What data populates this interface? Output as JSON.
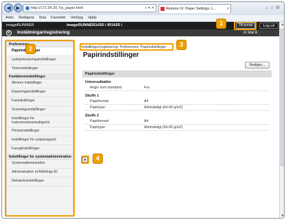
{
  "browser": {
    "back_glyph": "◀",
    "forward_glyph": "▶",
    "url": "http://172.24.20.7/p_paper.html",
    "url_tools": "⌕ ▾ ✕",
    "tab_label": "Remote UI: Paper Settings: L...",
    "tab_close": "×",
    "window_icons": "⌂☆⚙",
    "menu": [
      "Arkiv",
      "Redigera",
      "Visa",
      "Favoriter",
      "Verktyg",
      "Hjälp"
    ]
  },
  "header": {
    "left": "imageRUNNER",
    "model": "imageRUNNER1435 / iR1435 /",
    "portal_label": "Till portal",
    "logout_label": "Log ud",
    "app_icon": "⚙",
    "app_title": "Inställningar/registrering",
    "mail_label": "Mail til systemadministratör"
  },
  "sidebar": {
    "sections": [
      {
        "title": "Preferences",
        "items": [
          {
            "label": "Papirindstillinger",
            "active": true
          },
          {
            "label": "Lydstyrkestyringsindstillinger"
          },
          {
            "label": "Timerindstillinger"
          }
        ]
      },
      {
        "title": "Funktionsindstillinger",
        "items": [
          {
            "label": "Almene indstillinger"
          },
          {
            "label": "Kopieringsindstillinger"
          },
          {
            "label": "Faxindstillinger"
          },
          {
            "label": "Scanningsindstillinger"
          },
          {
            "label": "Indstillinger for hukommelsesmedieprint",
            "tall": true
          },
          {
            "label": "Printerindstillinger"
          },
          {
            "label": "Indstillinger for outputrapport"
          },
          {
            "label": "Faxoplindstillinger"
          }
        ]
      },
      {
        "title": "Indstillinger for systemadministration",
        "items": [
          {
            "label": "Systemadministration"
          },
          {
            "label": "Administration af Afdelings-ID"
          },
          {
            "label": "Netværksindstillinger"
          }
        ]
      }
    ]
  },
  "content": {
    "breadcrumb": "Indstillinger/registrering: Preferences: Papirindstillinger",
    "title": "Papirindstillinger",
    "edit_button": "Rediger...",
    "panel_title": "Papirindstillinger",
    "groups": [
      {
        "title": "Universalbakke",
        "rows": [
          {
            "k": "Angiv som standard:",
            "v": "Fra"
          }
        ]
      },
      {
        "title": "Skuffe 1",
        "rows": [
          {
            "k": "Papirformat:",
            "v": "A4"
          },
          {
            "k": "Papirtype:",
            "v": "Almindeligt (64-90 g/m2)"
          }
        ]
      },
      {
        "title": "Skuffe 2",
        "rows": [
          {
            "k": "Papirformat:",
            "v": "A4"
          },
          {
            "k": "Papirtype:",
            "v": "Almindeligt (64-90 g/m2)"
          }
        ]
      }
    ],
    "top_glyph": "▲"
  },
  "scrollbar": {
    "up": "▲",
    "down": "▼"
  },
  "callouts": [
    "1",
    "2",
    "3",
    "4"
  ],
  "colors": {
    "callout": "#f0a000",
    "header_dark": "#1e1e1e"
  }
}
